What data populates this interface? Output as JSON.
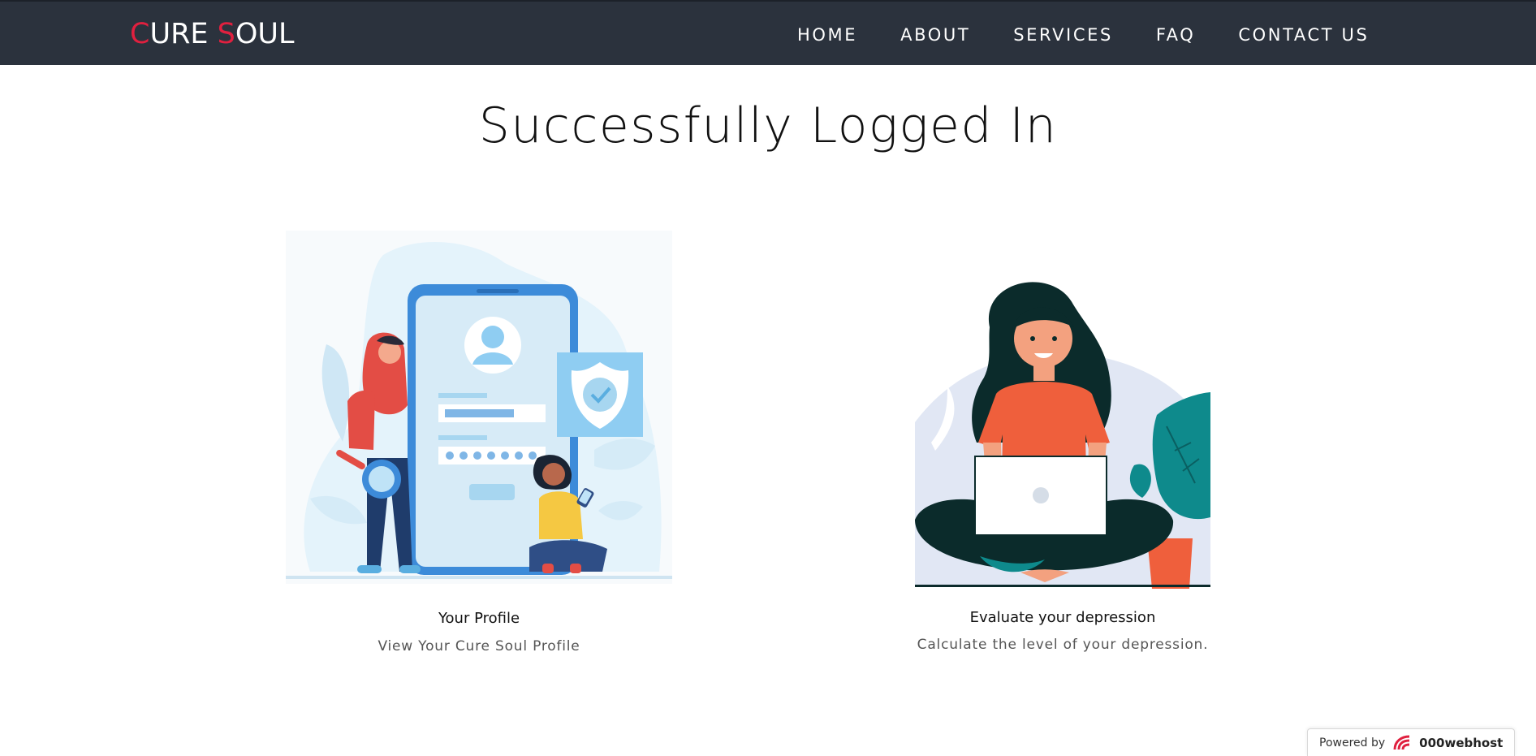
{
  "navbar": {
    "brand": {
      "c1": "C",
      "r1": "URE ",
      "c2": "S",
      "r2": "OUL"
    },
    "links": [
      "HOME",
      "ABOUT",
      "SERVICES",
      "FAQ",
      "CONTACT US"
    ]
  },
  "page_title": "Successfully Logged In",
  "cards": [
    {
      "title": "Your Profile",
      "text": "View Your Cure Soul Profile"
    },
    {
      "title": "Evaluate your depression",
      "text": "Calculate the level of your depression."
    }
  ],
  "badge": {
    "powered_by": "Powered by",
    "host": "000webhost"
  },
  "colors": {
    "navbar_bg": "#2b323d",
    "brand_accent": "#e0203f",
    "phone_blue": "#3d8bd9",
    "shirt_orange": "#ef5f3c",
    "plant_teal": "#0e8a8c"
  },
  "icons": [
    "user-avatar-icon",
    "shield-check-icon",
    "magnifier-icon",
    "laptop-icon",
    "webhost-logo-icon"
  ]
}
